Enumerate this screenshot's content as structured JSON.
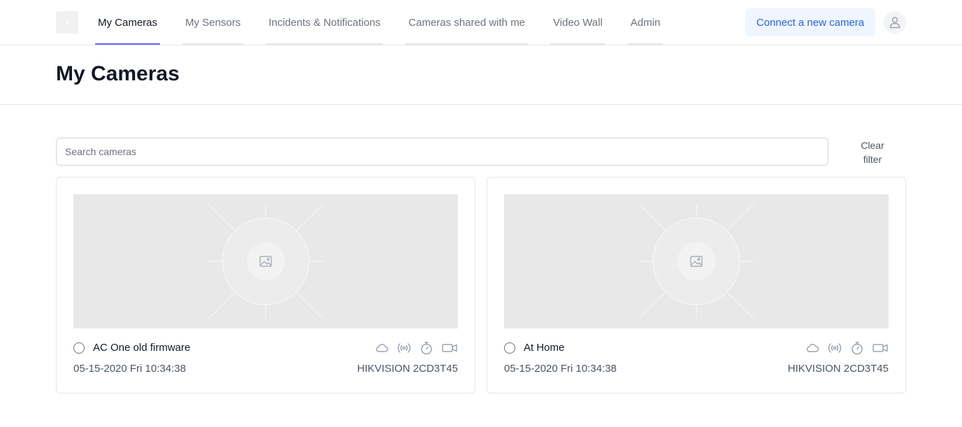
{
  "nav": {
    "logo": "app-logo",
    "items": [
      {
        "label": "My Cameras",
        "active": true
      },
      {
        "label": "My Sensors",
        "active": false
      },
      {
        "label": "Incidents & Notifications",
        "active": false
      },
      {
        "label": "Cameras shared with me",
        "active": false
      },
      {
        "label": "Video Wall",
        "active": false
      },
      {
        "label": "Admin",
        "active": false
      }
    ],
    "connect_label": "Connect a new camera",
    "avatar_icon": "user-icon",
    "accent_color": "#6366f1"
  },
  "page": {
    "title": "My Cameras"
  },
  "search": {
    "placeholder": "Search cameras",
    "value": ""
  },
  "clear_filter": {
    "line1": "Clear",
    "line2": "filter"
  },
  "cameras": [
    {
      "name": "AC One old firmware",
      "datetime": "05-15-2020 Fri 10:34:38",
      "model": "HIKVISION 2CD3T45",
      "thumbnail_icon": "image-placeholder-icon",
      "status_icons": [
        "cloud-icon",
        "broadcast-icon",
        "timer-icon",
        "video-camera-icon"
      ]
    },
    {
      "name": "At Home",
      "datetime": "05-15-2020 Fri 10:34:38",
      "model": "HIKVISION 2CD3T45",
      "thumbnail_icon": "image-placeholder-icon",
      "status_icons": [
        "cloud-icon",
        "broadcast-icon",
        "timer-icon",
        "video-camera-icon"
      ]
    }
  ]
}
